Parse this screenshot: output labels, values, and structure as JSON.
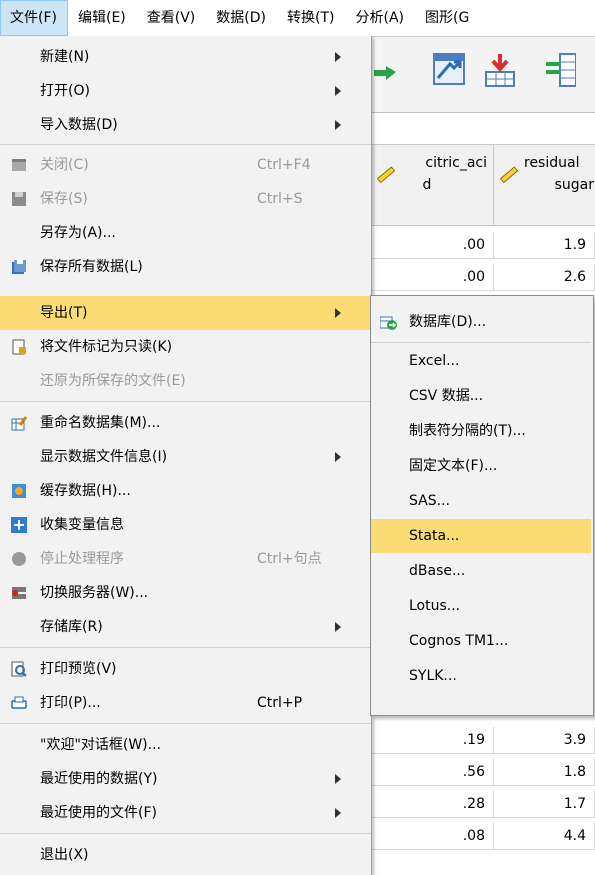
{
  "menubar": {
    "items": [
      {
        "label": "文件(F)",
        "active": true
      },
      {
        "label": "编辑(E)"
      },
      {
        "label": "查看(V)"
      },
      {
        "label": "数据(D)"
      },
      {
        "label": "转换(T)"
      },
      {
        "label": "分析(A)"
      },
      {
        "label": "图形(G"
      }
    ]
  },
  "grid": {
    "columns": [
      {
        "label_line1": "citric_aci",
        "label_line2": "d",
        "icon": "ruler-icon"
      },
      {
        "label_line1": "residual",
        "label_line2": "sugar",
        "icon": "ruler-icon"
      }
    ],
    "rows_top": [
      [
        ".00",
        "1.9"
      ],
      [
        ".00",
        "2.6"
      ]
    ],
    "rows_bottom": [
      [
        ".19",
        "3.9"
      ],
      [
        ".56",
        "1.8"
      ],
      [
        ".28",
        "1.7"
      ],
      [
        ".08",
        "4.4"
      ]
    ]
  },
  "file_menu": {
    "items": [
      {
        "label": "新建(N)",
        "submenu": true
      },
      {
        "label": "打开(O)",
        "submenu": true
      },
      {
        "label": "导入数据(D)",
        "submenu": true
      },
      {
        "label": "关闭(C)",
        "shortcut": "Ctrl+F4",
        "disabled": true,
        "icon": "close-window-icon"
      },
      {
        "label": "保存(S)",
        "shortcut": "Ctrl+S",
        "disabled": true,
        "icon": "save-icon"
      },
      {
        "label": "另存为(A)..."
      },
      {
        "label": "保存所有数据(L)",
        "icon": "save-all-icon"
      },
      {
        "label": "导出(T)",
        "submenu": true,
        "selected": true
      },
      {
        "label": "将文件标记为只读(K)",
        "icon": "read-only-icon"
      },
      {
        "label": "还原为所保存的文件(E)",
        "disabled": true
      },
      {
        "label": "重命名数据集(M)...",
        "icon": "rename-icon"
      },
      {
        "label": "显示数据文件信息(I)",
        "submenu": true
      },
      {
        "label": "缓存数据(H)...",
        "icon": "cache-icon"
      },
      {
        "label": "收集变量信息",
        "icon": "plus-icon"
      },
      {
        "label": "停止处理程序",
        "shortcut": "Ctrl+句点",
        "disabled": true,
        "icon": "stop-icon"
      },
      {
        "label": "切换服务器(W)...",
        "icon": "server-icon"
      },
      {
        "label": "存储库(R)",
        "submenu": true
      },
      {
        "label": "打印预览(V)",
        "icon": "print-preview-icon"
      },
      {
        "label": "打印(P)...",
        "shortcut": "Ctrl+P",
        "icon": "print-icon"
      },
      {
        "label": "\"欢迎\"对话框(W)..."
      },
      {
        "label": "最近使用的数据(Y)",
        "submenu": true
      },
      {
        "label": "最近使用的文件(F)",
        "submenu": true
      },
      {
        "label": "退出(X)"
      }
    ]
  },
  "export_submenu": {
    "items": [
      {
        "label": "数据库(D)...",
        "icon": "database-icon"
      },
      {
        "label": "Excel..."
      },
      {
        "label": "CSV 数据..."
      },
      {
        "label": "制表符分隔的(T)..."
      },
      {
        "label": "固定文本(F)..."
      },
      {
        "label": "SAS..."
      },
      {
        "label": "Stata...",
        "selected": true
      },
      {
        "label": "dBase..."
      },
      {
        "label": "Lotus..."
      },
      {
        "label": "Cognos TM1..."
      },
      {
        "label": "SYLK..."
      }
    ]
  },
  "colors": {
    "highlight": "#fbdc74",
    "menubar_active": "#cde6f7",
    "disabled_text": "#9a9a9a"
  }
}
